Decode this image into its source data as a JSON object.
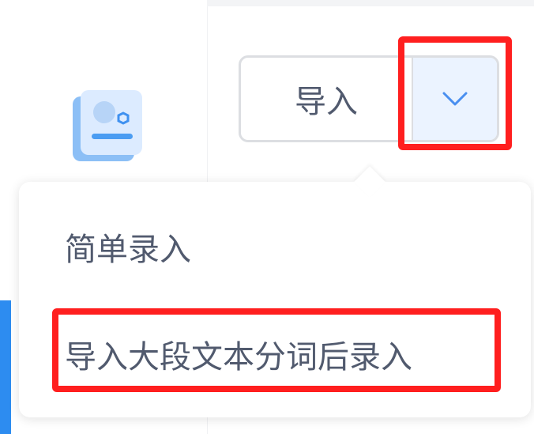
{
  "toolbar": {
    "import_label": "导入",
    "dropdown_icon": "chevron-down-icon"
  },
  "dropdown_menu": {
    "items": [
      {
        "label": "简单录入"
      },
      {
        "label": "导入大段文本分词后录入"
      }
    ]
  },
  "colors": {
    "accent": "#2d8cf0",
    "highlight": "#ff1f1f",
    "text": "#515a6e",
    "toggle_bg": "#ebf3ff"
  }
}
